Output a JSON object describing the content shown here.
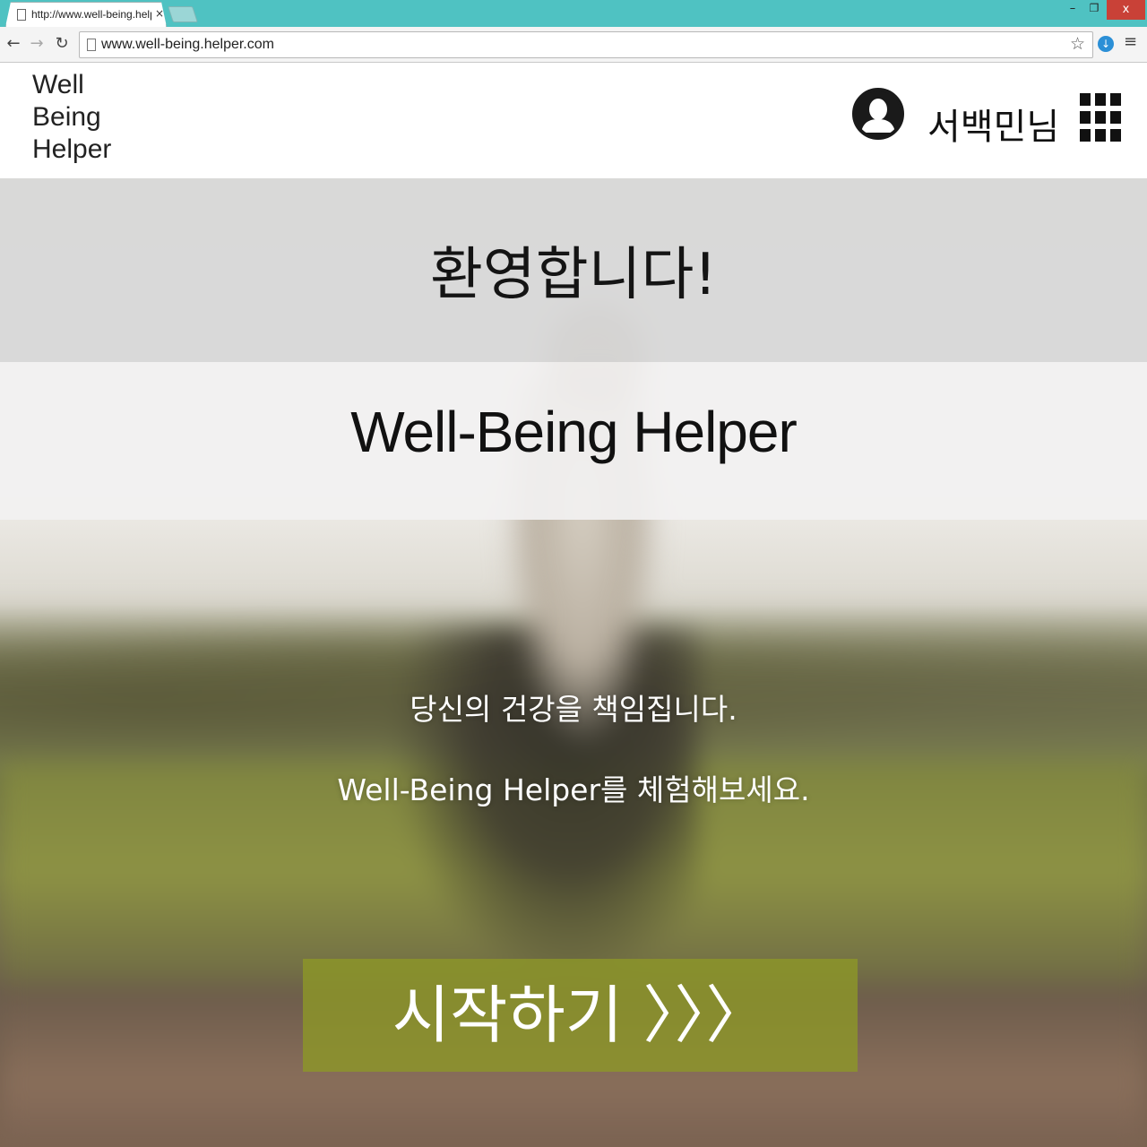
{
  "browser": {
    "tab_title": "http://www.well-being.helper.com",
    "tab_close": "×",
    "window_min": "–",
    "window_restore": "❐",
    "window_close": "x",
    "nav_back": "←",
    "nav_forward": "→",
    "nav_reload": "↻",
    "url": "www.well-being.helper.com",
    "bookmark_star": "☆",
    "extension_glyph": "↓",
    "menu_glyph": "≡"
  },
  "header": {
    "logo_lines": [
      "Well",
      "Being",
      "Helper"
    ],
    "user_name": "서백민님",
    "avatar_icon": "user-silhouette-icon",
    "apps_icon": "apps-grid-icon"
  },
  "hero": {
    "welcome": "환영합니다!",
    "brand": "Well-Being Helper",
    "tagline_1": "당신의 건강을 책임집니다.",
    "tagline_2": "Well-Being Helper를 체험해보세요.",
    "start_button": "시작하기 〉〉〉"
  },
  "colors": {
    "titlebar": "#4fc2c2",
    "close_button": "#c94137",
    "start_button": "#8c9628"
  }
}
